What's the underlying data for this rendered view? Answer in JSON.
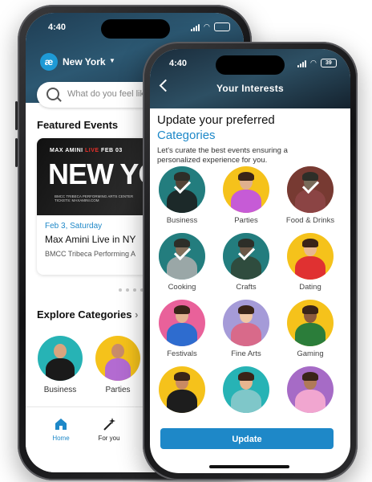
{
  "colors": {
    "accent": "#1e88c8",
    "yellow": "#f5c21b",
    "teal": "#27b3b5",
    "text": "#111111"
  },
  "back_screen": {
    "status_time": "4:40",
    "logo_glyph": "æ",
    "city": "New York",
    "search_placeholder": "What do you feel like",
    "featured_title": "Featured Events",
    "event": {
      "poster_line": "MAX AMINI",
      "poster_live": "LIVE",
      "poster_date": "FEB 03",
      "poster_title": "NEW YORK",
      "poster_sub": "BMCC TRIBECA PERFORMING ARTS CENTER",
      "poster_sub2": "TICKETS: MAXAMINI.COM",
      "date": "Feb 3, Saturday",
      "name": "Max Amini Live in NY",
      "venue": "BMCC Tribeca Performing A"
    },
    "carousel": {
      "count": 6,
      "active_index": 5
    },
    "explore_title": "Explore Categories",
    "explore_chevron": "›",
    "categories": [
      {
        "label": "Business",
        "bg": "#27b3b5"
      },
      {
        "label": "Parties",
        "bg": "#f5c21b"
      }
    ],
    "nav": [
      {
        "label": "Home",
        "icon": "home-icon",
        "active": true
      },
      {
        "label": "For you",
        "icon": "magic-wand-icon",
        "active": false
      }
    ]
  },
  "front_screen": {
    "status_time": "4:40",
    "battery": "39",
    "header_title": "Your Interests",
    "title_line1": "Update your preferred",
    "title_line2": "Categories",
    "description": "Let's curate the best events ensuring a personalized experience for you.",
    "categories": [
      {
        "label": "Business",
        "bg": "#27b3b5",
        "selected": true
      },
      {
        "label": "Parties",
        "bg": "#f5c21b",
        "selected": false
      },
      {
        "label": "Food & Drinks",
        "bg": "#c0392b",
        "selected": true
      },
      {
        "label": "Cooking",
        "bg": "#27b3b5",
        "selected": true
      },
      {
        "label": "Crafts",
        "bg": "#27b3b5",
        "selected": true
      },
      {
        "label": "Dating",
        "bg": "#f5c21b",
        "selected": false
      },
      {
        "label": "Festivals",
        "bg": "#e9619a",
        "selected": false
      },
      {
        "label": "Fine Arts",
        "bg": "#a59bd8",
        "selected": false
      },
      {
        "label": "Gaming",
        "bg": "#f5c21b",
        "selected": false
      },
      {
        "label": "",
        "bg": "#f5c21b",
        "selected": false
      },
      {
        "label": "",
        "bg": "#27b3b5",
        "selected": false
      },
      {
        "label": "",
        "bg": "#a66bc6",
        "selected": false
      }
    ],
    "update_label": "Update"
  }
}
